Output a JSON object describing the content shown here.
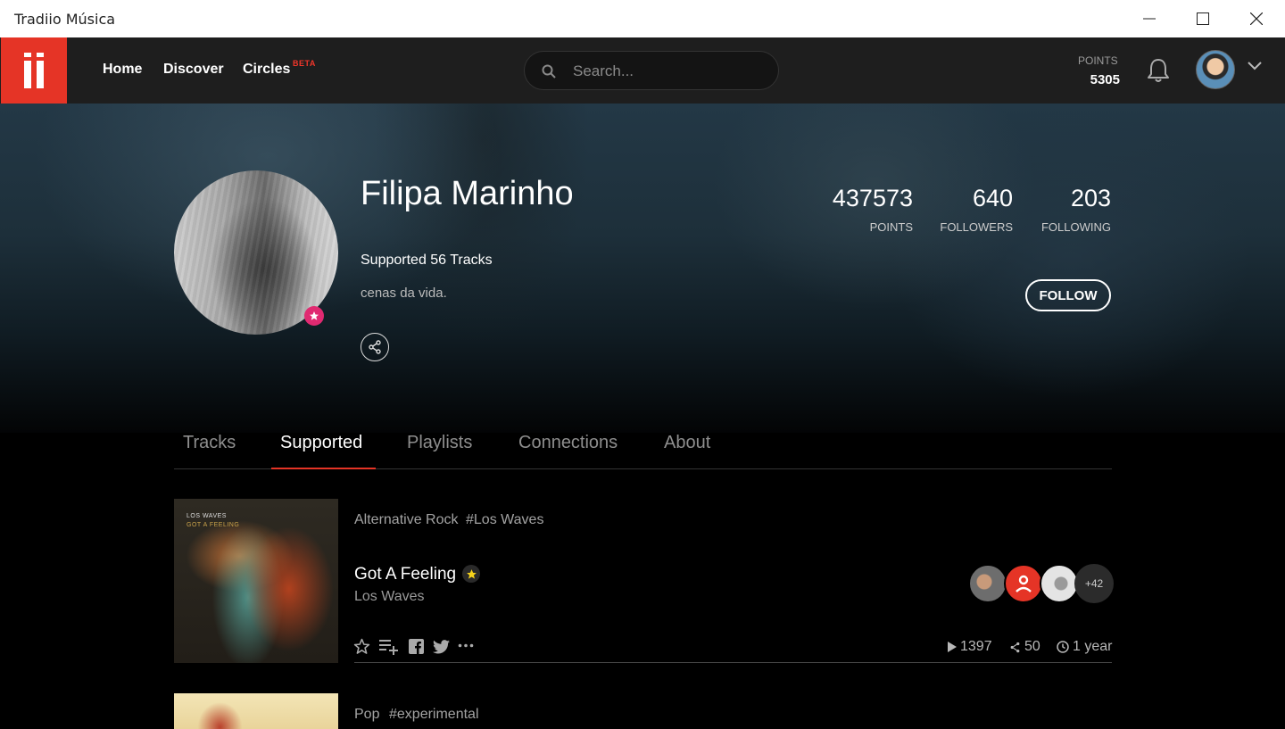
{
  "window": {
    "title": "Tradiio Música"
  },
  "nav": {
    "home": "Home",
    "discover": "Discover",
    "circles": "Circles",
    "beta": "BETA"
  },
  "search": {
    "placeholder": "Search..."
  },
  "user_points": {
    "label": "POINTS",
    "value": "5305"
  },
  "profile": {
    "name": "Filipa Marinho",
    "supported": "Supported 56 Tracks",
    "bio": "cenas da vida.",
    "follow_label": "FOLLOW",
    "stats": [
      {
        "value": "437573",
        "label": "POINTS"
      },
      {
        "value": "640",
        "label": "FOLLOWERS"
      },
      {
        "value": "203",
        "label": "FOLLOWING"
      }
    ]
  },
  "tabs": [
    {
      "label": "Tracks"
    },
    {
      "label": "Supported",
      "active": true
    },
    {
      "label": "Playlists"
    },
    {
      "label": "Connections"
    },
    {
      "label": "About"
    }
  ],
  "tracks": [
    {
      "genre": "Alternative Rock",
      "tag": "#Los Waves",
      "title": "Got A Feeling",
      "artist": "Los Waves",
      "cover_text_1": "LOS WAVES",
      "cover_text_2": "GOT A FEELING",
      "supporters_more": "+42",
      "plays": "1397",
      "shares": "50",
      "age": "1 year"
    },
    {
      "genre": "Pop",
      "tag": "#experimental"
    }
  ],
  "colors": {
    "brand": "#e53426",
    "badge": "#e02a71",
    "star": "#f5d21b"
  },
  "icons": [
    "search-icon",
    "bell-icon",
    "chevron-down-icon",
    "share-icon",
    "star-icon",
    "playlist-add-icon",
    "facebook-icon",
    "twitter-icon",
    "more-icon",
    "play-icon",
    "clock-icon"
  ]
}
